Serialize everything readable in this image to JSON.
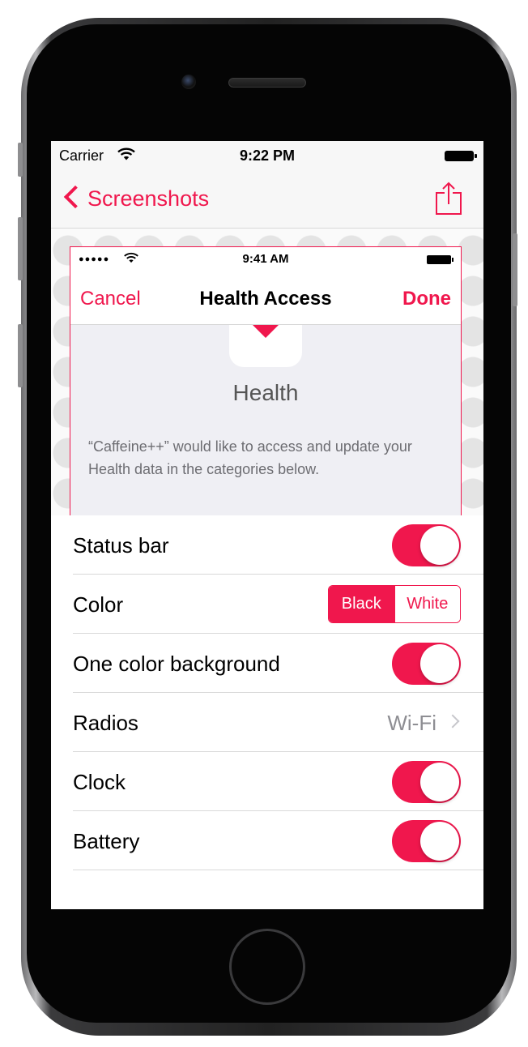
{
  "status_bar": {
    "carrier": "Carrier",
    "time": "9:22 PM"
  },
  "nav_bar": {
    "back_label": "Screenshots",
    "share_icon": "share-icon"
  },
  "preview": {
    "status_bar": {
      "signal": "●●●●●",
      "time": "9:41 AM"
    },
    "nav": {
      "cancel": "Cancel",
      "title": "Health Access",
      "done": "Done"
    },
    "app_name": "Health",
    "description": "“Caffeine++” would like to access and update your Health data in the categories below."
  },
  "settings": {
    "status_bar": {
      "label": "Status bar",
      "on": true
    },
    "color": {
      "label": "Color",
      "options": [
        "Black",
        "White"
      ],
      "selected": "Black"
    },
    "one_color_background": {
      "label": "One color background",
      "on": true
    },
    "radios": {
      "label": "Radios",
      "value": "Wi-Fi"
    },
    "clock": {
      "label": "Clock",
      "on": true
    },
    "battery": {
      "label": "Battery",
      "on": true
    }
  },
  "colors": {
    "accent": "#f0174d",
    "secondary_text": "#8e8e93",
    "separator": "#d9d9d9"
  }
}
